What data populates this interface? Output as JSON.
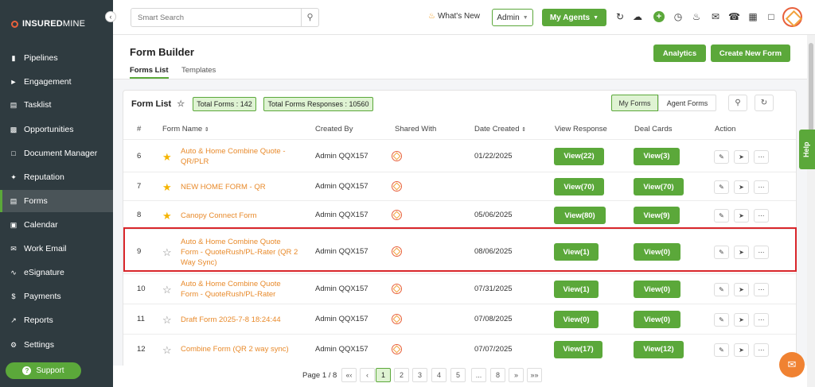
{
  "brand": {
    "name_bold": "INSURED",
    "name_light": "MINE"
  },
  "sidebar": {
    "items": [
      {
        "label": "Pipelines",
        "icon": "pipeline-icon"
      },
      {
        "label": "Engagement",
        "icon": "megaphone-icon"
      },
      {
        "label": "Tasklist",
        "icon": "tasklist-icon"
      },
      {
        "label": "Opportunities",
        "icon": "bar-chart-icon"
      },
      {
        "label": "Document Manager",
        "icon": "folder-icon"
      },
      {
        "label": "Reputation",
        "icon": "reputation-icon"
      },
      {
        "label": "Forms",
        "icon": "forms-icon",
        "active": true
      },
      {
        "label": "Calendar",
        "icon": "calendar-icon"
      },
      {
        "label": "Work Email",
        "icon": "mail-icon"
      },
      {
        "label": "eSignature",
        "icon": "signature-icon"
      },
      {
        "label": "Payments",
        "icon": "dollar-icon"
      },
      {
        "label": "Reports",
        "icon": "line-chart-icon"
      },
      {
        "label": "Settings",
        "icon": "gear-icon"
      }
    ],
    "support_label": "Support"
  },
  "topbar": {
    "search_placeholder": "Smart Search",
    "whats_new": "What's New",
    "role_select": "Admin",
    "agents_button": "My Agents"
  },
  "header": {
    "title": "Form Builder",
    "tabs": [
      "Forms List",
      "Templates"
    ],
    "analytics_button": "Analytics",
    "create_button": "Create New Form"
  },
  "form_list": {
    "title": "Form List",
    "total_forms": "Total Forms : 142",
    "total_responses": "Total Forms Responses : 10560",
    "toggle": [
      "My Forms",
      "Agent Forms"
    ],
    "columns": [
      "#",
      "Form Name",
      "Created By",
      "Shared With",
      "Date Created",
      "View Response",
      "Deal Cards",
      "Action"
    ],
    "rows": [
      {
        "num": "6",
        "starred": true,
        "name_lines": [
          "Auto & Home Combine Quote -",
          "QR/PLR"
        ],
        "created_by": "Admin QQX157",
        "date": "01/22/2025",
        "view": "View(22)",
        "deal": "View(3)"
      },
      {
        "num": "7",
        "starred": true,
        "name_lines": [
          "NEW HOME FORM - QR"
        ],
        "created_by": "Admin QQX157",
        "date": "",
        "view": "View(70)",
        "deal": "View(70)"
      },
      {
        "num": "8",
        "starred": true,
        "name_lines": [
          "Canopy Connect Form"
        ],
        "created_by": "Admin QQX157",
        "date": "05/06/2025",
        "view": "View(80)",
        "deal": "View(9)"
      },
      {
        "num": "9",
        "starred": false,
        "name_lines": [
          "Auto & Home Combine Quote",
          "Form - QuoteRush/PL-Rater (QR 2",
          "Way Sync)"
        ],
        "created_by": "Admin QQX157",
        "date": "08/06/2025",
        "view": "View(1)",
        "deal": "View(0)"
      },
      {
        "num": "10",
        "starred": false,
        "name_lines": [
          "Auto & Home Combine Quote",
          "Form - QuoteRush/PL-Rater"
        ],
        "created_by": "Admin QQX157",
        "date": "07/31/2025",
        "view": "View(1)",
        "deal": "View(0)"
      },
      {
        "num": "11",
        "starred": false,
        "name_lines": [
          "Draft Form 2025-7-8 18:24:44"
        ],
        "created_by": "Admin QQX157",
        "date": "07/08/2025",
        "view": "View(0)",
        "deal": "View(0)"
      },
      {
        "num": "12",
        "starred": false,
        "name_lines": [
          "Combine Form (QR 2 way sync)"
        ],
        "created_by": "Admin QQX157",
        "date": "07/07/2025",
        "view": "View(17)",
        "deal": "View(12)"
      }
    ]
  },
  "pagination": {
    "label": "Page 1 / 8",
    "pages": [
      "«‹",
      "‹",
      "1",
      "2",
      "3",
      "4",
      "5",
      "...",
      "8",
      "»",
      "»»"
    ],
    "current": "1"
  },
  "help_label": "Help",
  "colors": {
    "accent": "#5ba83a",
    "sidebar": "#2f3b40",
    "link": "#e88a2b",
    "highlight": "#d9262b"
  }
}
